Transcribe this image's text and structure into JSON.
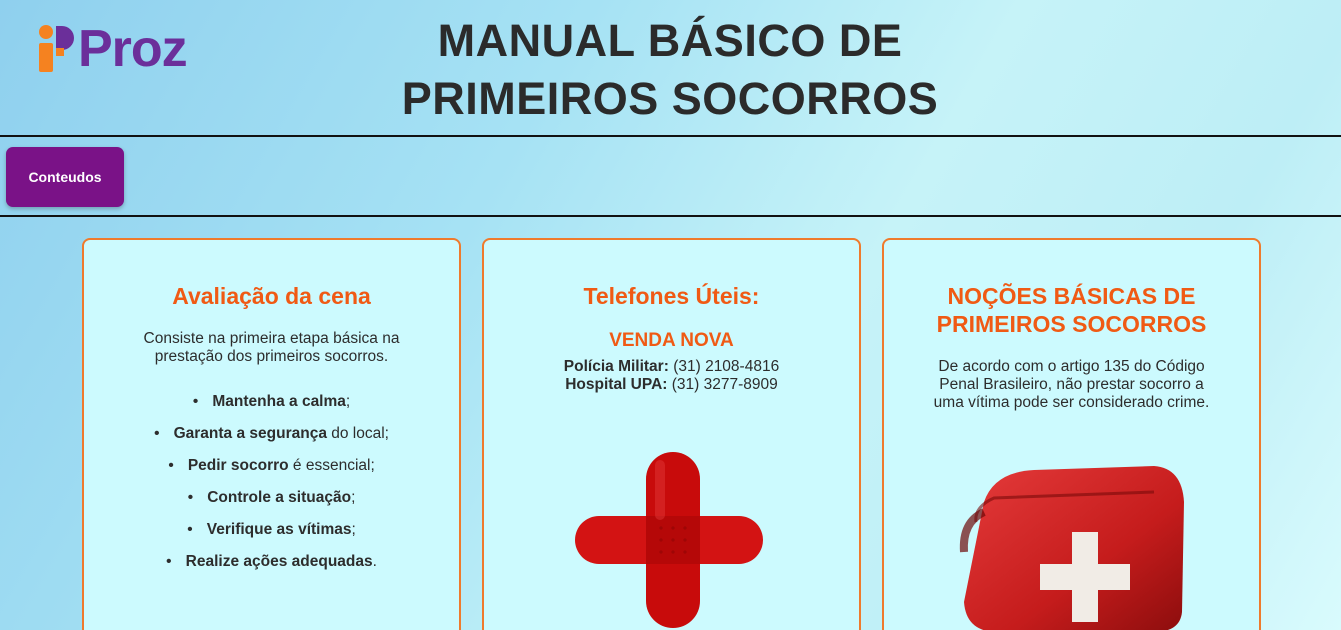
{
  "header": {
    "logo_text": "Proz",
    "title_line1": "MANUAL BÁSICO DE",
    "title_line2": "PRIMEIROS SOCORROS"
  },
  "nav": {
    "button_label": "Conteudos"
  },
  "cards": {
    "scene": {
      "title": "Avaliação da cena",
      "intro": "Consiste na primeira etapa básica na prestação dos primeiros socorros.",
      "items": [
        {
          "bold": "Mantenha a calma",
          "rest": ";"
        },
        {
          "bold": "Garanta a segurança",
          "rest": " do local;"
        },
        {
          "bold": "Pedir socorro",
          "rest": " é essencial;"
        },
        {
          "bold": "Controle a situação",
          "rest": ";"
        },
        {
          "bold": "Verifique as vítimas",
          "rest": ";"
        },
        {
          "bold": "Realize ações adequadas",
          "rest": "."
        }
      ]
    },
    "phones": {
      "title": "Telefones Úteis:",
      "region": "VENDA NOVA",
      "entries": [
        {
          "label": "Polícia Militar:",
          "number": " (31) 2108-4816"
        },
        {
          "label": "Hospital UPA:",
          "number": " (31) 3277-8909"
        }
      ],
      "image_icon": "bandage-cross-icon"
    },
    "basics": {
      "title_line1": "NOÇÕES BÁSICAS DE",
      "title_line2": "PRIMEIROS SOCORROS",
      "text": "De acordo com o artigo 135 do Código Penal Brasileiro, não prestar socorro a uma vítima pode ser considerado crime.",
      "image_icon": "first-aid-kit-icon"
    }
  },
  "colors": {
    "accent_orange": "#f05a14",
    "nav_purple": "#7a1287",
    "logo_purple": "#6b2f9a",
    "logo_orange": "#f58220",
    "card_bg": "#ccfafe"
  }
}
